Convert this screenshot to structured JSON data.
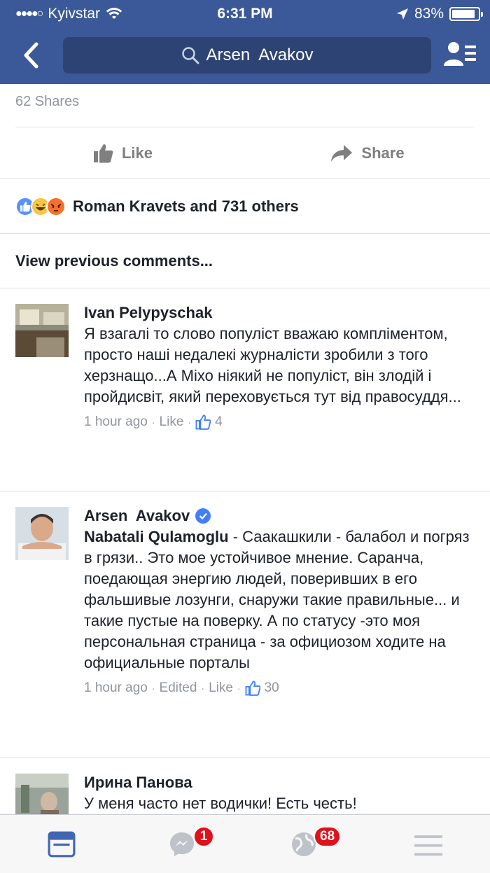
{
  "status_bar": {
    "carrier": "Kyivstar",
    "time": "6:31 PM",
    "battery": "83%",
    "battery_level": 0.83
  },
  "header": {
    "search_text": "Arsen  Avakov"
  },
  "post": {
    "shares": "62 Shares",
    "like_label": "Like",
    "share_label": "Share",
    "reactions_text": "Roman Kravets and 731 others",
    "view_previous": "View previous comments..."
  },
  "comments": [
    {
      "author": "Ivan Pelypyschak",
      "text": "Я взагалі то слово популіст вважаю компліментом, просто наші недалекі журналісти зробили з того херзнащо...А Міхо ніякий не популіст, він злодій і пройдисвіт, який переховується тут від правосуддя...",
      "time": "1 hour ago",
      "like": "Like",
      "likes": "4"
    },
    {
      "author": "Arsen  Avakov",
      "mention": "Nabatali Qulamoglu",
      "text": " - Саакашкили - балабол и погряз в грязи.. Это мое устойчивое мнение. Саранча, поедающая энергию людей, поверивших в его фальшивые лозунги, снаружи такие правильные... и такие пустые на поверку. А по статусу -это моя персональная страница - за официозом ходите на официальные порталы",
      "time": "1 hour ago",
      "edited": "Edited",
      "like": "Like",
      "likes": "30"
    },
    {
      "author": "Ирина Панова",
      "text": "У меня часто нет водички! Есть честь!"
    }
  ],
  "tabbar": {
    "messenger_badge": "1",
    "notifications_badge": "68"
  },
  "colors": {
    "brand": "#3b5998",
    "link_blue": "#4080ff",
    "badge_red": "#e0111b"
  }
}
